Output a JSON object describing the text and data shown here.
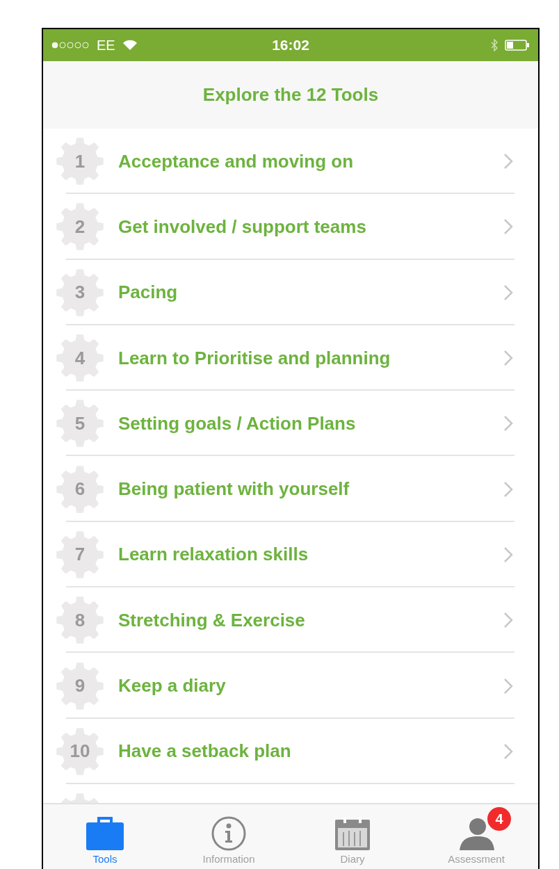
{
  "status_bar": {
    "carrier": "EE",
    "time": "16:02"
  },
  "header": {
    "title": "Explore the 12 Tools"
  },
  "tools": [
    {
      "number": "1",
      "label": "Acceptance and moving on"
    },
    {
      "number": "2",
      "label": "Get involved / support teams"
    },
    {
      "number": "3",
      "label": "Pacing"
    },
    {
      "number": "4",
      "label": "Learn to Prioritise and planning"
    },
    {
      "number": "5",
      "label": "Setting goals / Action Plans"
    },
    {
      "number": "6",
      "label": "Being patient with yourself"
    },
    {
      "number": "7",
      "label": "Learn relaxation skills"
    },
    {
      "number": "8",
      "label": "Stretching & Exercise"
    },
    {
      "number": "9",
      "label": "Keep a diary"
    },
    {
      "number": "10",
      "label": "Have a setback plan"
    }
  ],
  "tab_bar": [
    {
      "kind": "briefcase",
      "label": "Tools",
      "selected": true
    },
    {
      "kind": "info",
      "label": "Information",
      "selected": false
    },
    {
      "kind": "calendar",
      "label": "Diary",
      "selected": false
    },
    {
      "kind": "person",
      "label": "Assessment",
      "selected": false,
      "badge": "4"
    }
  ]
}
